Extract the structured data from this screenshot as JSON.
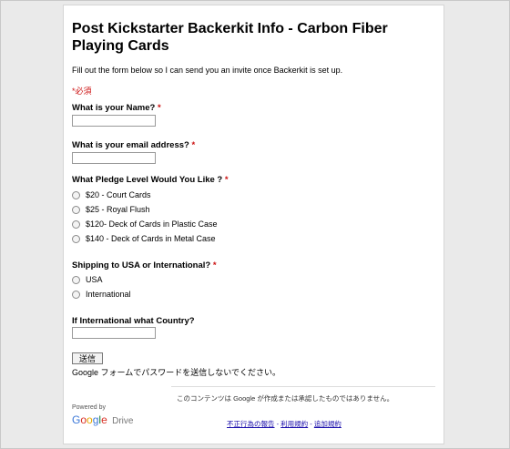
{
  "form": {
    "title": "Post Kickstarter Backerkit Info - Carbon Fiber Playing Cards",
    "description": "Fill out the form below so I can send you an invite once Backerkit is set up.",
    "required_note": "*必須",
    "questions": [
      {
        "label": "What is your Name?",
        "required_mark": "*",
        "value": ""
      },
      {
        "label": "What is your email address?",
        "required_mark": "*",
        "value": ""
      },
      {
        "label": "What Pledge Level Would You Like ?",
        "required_mark": "*",
        "options": [
          "$20 - Court Cards",
          "$25 - Royal Flush",
          "$120- Deck of Cards in Plastic Case",
          "$140 - Deck of Cards in Metal Case"
        ]
      },
      {
        "label": "Shipping to USA or International?",
        "required_mark": "*",
        "options": [
          "USA",
          "International"
        ]
      },
      {
        "label": "If International what Country?",
        "value": ""
      }
    ],
    "submit_label": "送信",
    "password_warning": "Google フォームでパスワードを送信しないでください。"
  },
  "footer": {
    "disclaimer": "このコンテンツは Google が作成または承認したものではありません。",
    "powered_by": "Powered by",
    "brand_letters": [
      "G",
      "o",
      "o",
      "g",
      "l",
      "e"
    ],
    "brand_product": "Drive",
    "links": [
      "不正行為の報告",
      "利用規約",
      "追加規約"
    ],
    "link_separator": " - "
  },
  "colors": {
    "required": "#cc1111",
    "link": "#1a0dab",
    "page_bg": "#eaeaea",
    "card_bg": "#ffffff"
  }
}
